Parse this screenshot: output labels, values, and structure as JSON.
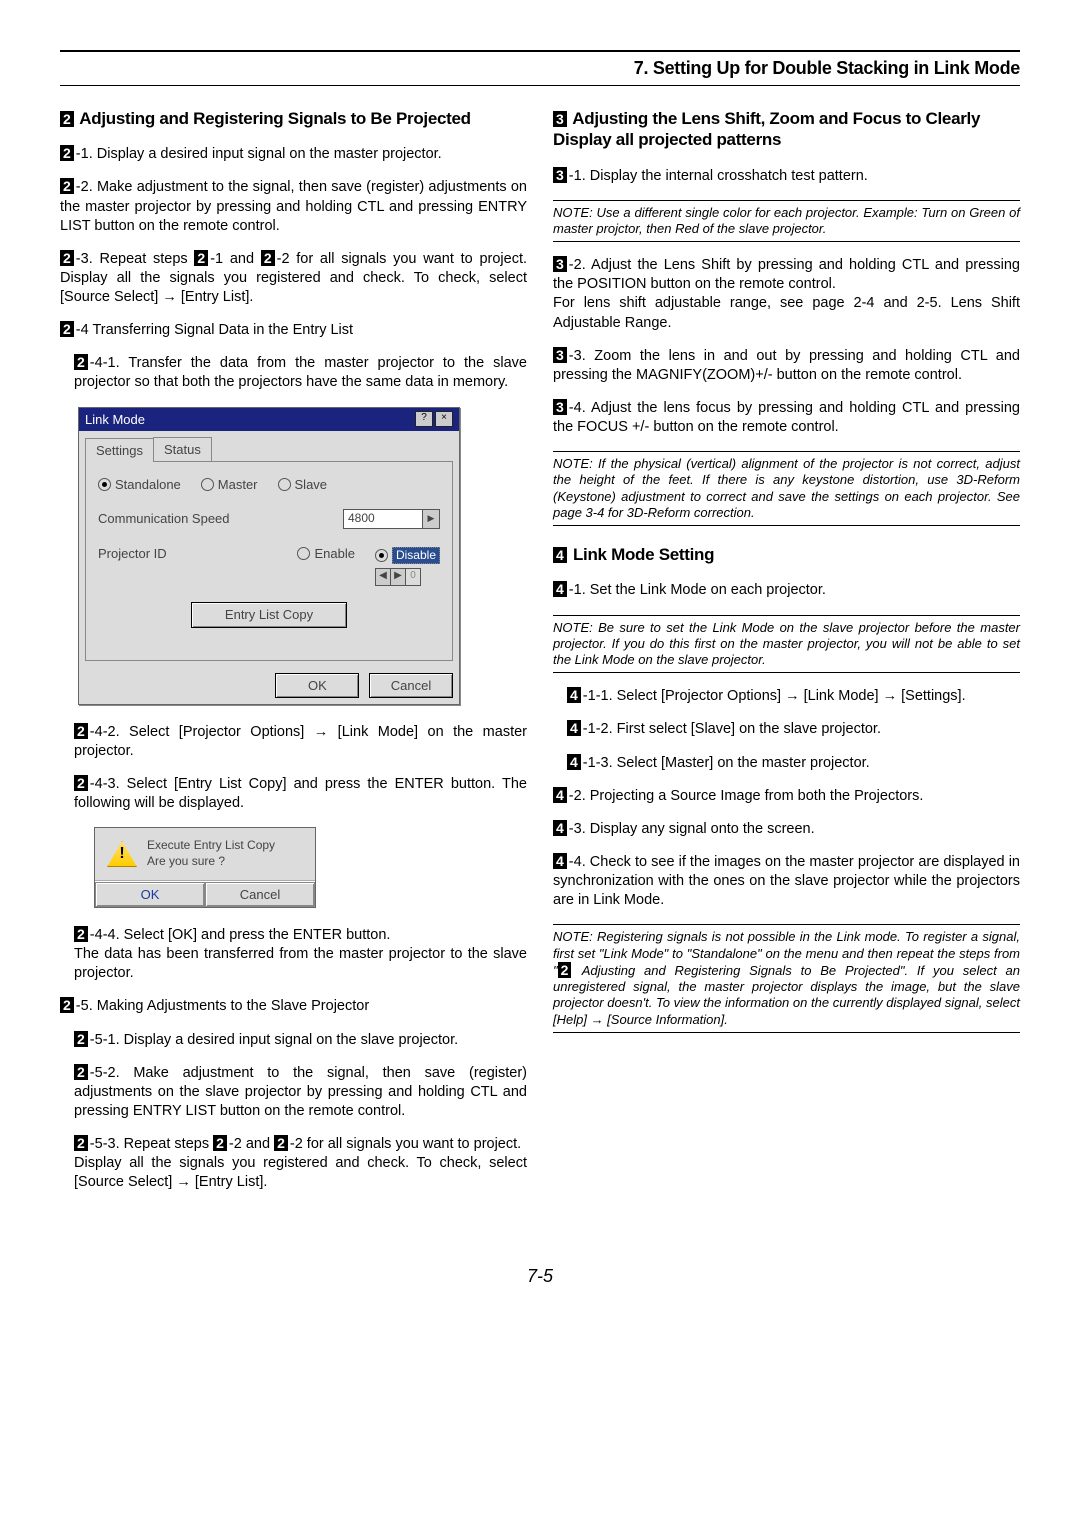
{
  "chapter_title": "7. Setting Up for Double Stacking in Link Mode",
  "page_number": "7-5",
  "section2": {
    "heading_num": "2",
    "heading": "Adjusting and Registering Signals to Be Projected",
    "s2_1": "-1. Display a desired input signal on the master projector.",
    "s2_2": "-2. Make adjustment to the signal, then save (register) adjustments on the master projector by pressing and holding CTL and pressing ENTRY LIST button on the remote control.",
    "s2_3_a": "-3. Repeat steps ",
    "s2_3_b": "-1 and ",
    "s2_3_c": "-2 for all signals you want to project. Display all the signals you registered and check. To check, select [Source Select] → [Entry List].",
    "s2_4": "-4 Transferring Signal Data in the Entry List",
    "s2_4_1": "-4-1. Transfer the data from the master projector to the slave projector so that both the projectors have the same data in memory.",
    "s2_4_2": "-4-2. Select [Projector Options] → [Link Mode] on the master projector.",
    "s2_4_3": "-4-3. Select [Entry List Copy] and press the ENTER button. The following will be displayed.",
    "s2_4_4": "-4-4. Select [OK] and press the ENTER button.",
    "s2_4_4b": "The data has been transferred from the master projector to the slave projector.",
    "s2_5": "-5. Making Adjustments to the Slave Projector",
    "s2_5_1": "-5-1. Display a desired input signal on the slave projector.",
    "s2_5_2": "-5-2. Make adjustment to the signal, then save (register) adjustments on the slave projector by pressing and holding CTL and pressing ENTRY LIST button on the remote control.",
    "s2_5_3_a": "-5-3. Repeat steps ",
    "s2_5_3_b": "-2 and ",
    "s2_5_3_c": "-2 for all signals you want to project.",
    "s2_5_3_d": "Display all the signals you registered and check. To check, select [Source Select] → [Entry List]."
  },
  "dlg": {
    "title": "Link Mode",
    "tabs": {
      "settings": "Settings",
      "status": "Status"
    },
    "mode": {
      "standalone": "Standalone",
      "master": "Master",
      "slave": "Slave"
    },
    "comm_label": "Communication Speed",
    "comm_value": "4800",
    "projector_id_label": "Projector ID",
    "enable": "Enable",
    "disable": "Disable",
    "entry_list_copy": "Entry List Copy",
    "ok": "OK",
    "cancel": "Cancel"
  },
  "confirm": {
    "line1": "Execute Entry List Copy",
    "line2": "Are you sure ?",
    "ok": "OK",
    "cancel": "Cancel"
  },
  "section3": {
    "heading_num": "3",
    "heading": "Adjusting the Lens Shift, Zoom and Focus to Clearly Display all projected patterns",
    "s3_1": "-1. Display the internal crosshatch test pattern.",
    "note1": "NOTE: Use a different single color for each projector. Example: Turn on Green of master projctor, then Red of the slave projector.",
    "s3_2": "-2. Adjust the Lens Shift by pressing and holding CTL and pressing the POSITION button on the remote control.",
    "s3_2b": "For lens shift adjustable range, see page 2-4 and 2-5. Lens Shift Adjustable Range.",
    "s3_3": "-3. Zoom the lens in and out by pressing and holding CTL and pressing the MAGNIFY(ZOOM)+/- button on the remote control.",
    "s3_4": "-4. Adjust the lens focus by pressing and holding CTL and pressing the FOCUS +/- button on the remote control.",
    "note2": "NOTE: If the physical (vertical) alignment of the projector is not correct, adjust the height of the feet. If there is any keystone distortion, use 3D-Reform (Keystone) adjustment to correct and save the settings on each projector. See page 3-4 for 3D-Reform correction."
  },
  "section4": {
    "heading_num": "4",
    "heading": "Link Mode Setting",
    "s4_1": "-1. Set the Link Mode on each projector.",
    "note1": "NOTE: Be sure to set the Link Mode on the slave projector before the master projector. If you do this first on the master projector, you will not be able to set the Link Mode on the slave projector.",
    "s4_1_1": "-1-1. Select [Projector Options] → [Link Mode] → [Settings].",
    "s4_1_2": "-1-2. First select [Slave] on the slave projector.",
    "s4_1_3": "-1-3. Select [Master] on the master projector.",
    "s4_2": "-2. Projecting a Source Image from both the Projectors.",
    "s4_3": "-3. Display any signal onto the screen.",
    "s4_4": "-4. Check to see if the images on the master projector are displayed in synchronization with the ones on the slave projector while the projectors are in Link Mode.",
    "note2a": "NOTE: Registering signals is not possible in the Link mode. To register a signal, first set \"Link Mode\" to \"Standalone\" on the menu and then repeat the steps from \"",
    "note2b": " Adjusting and Registering Signals to Be Projected\". If you select an unregistered signal, the master projector displays the image, but the slave projector doesn't. To view the information on the currently displayed signal, select [Help] → [Source Information]."
  }
}
